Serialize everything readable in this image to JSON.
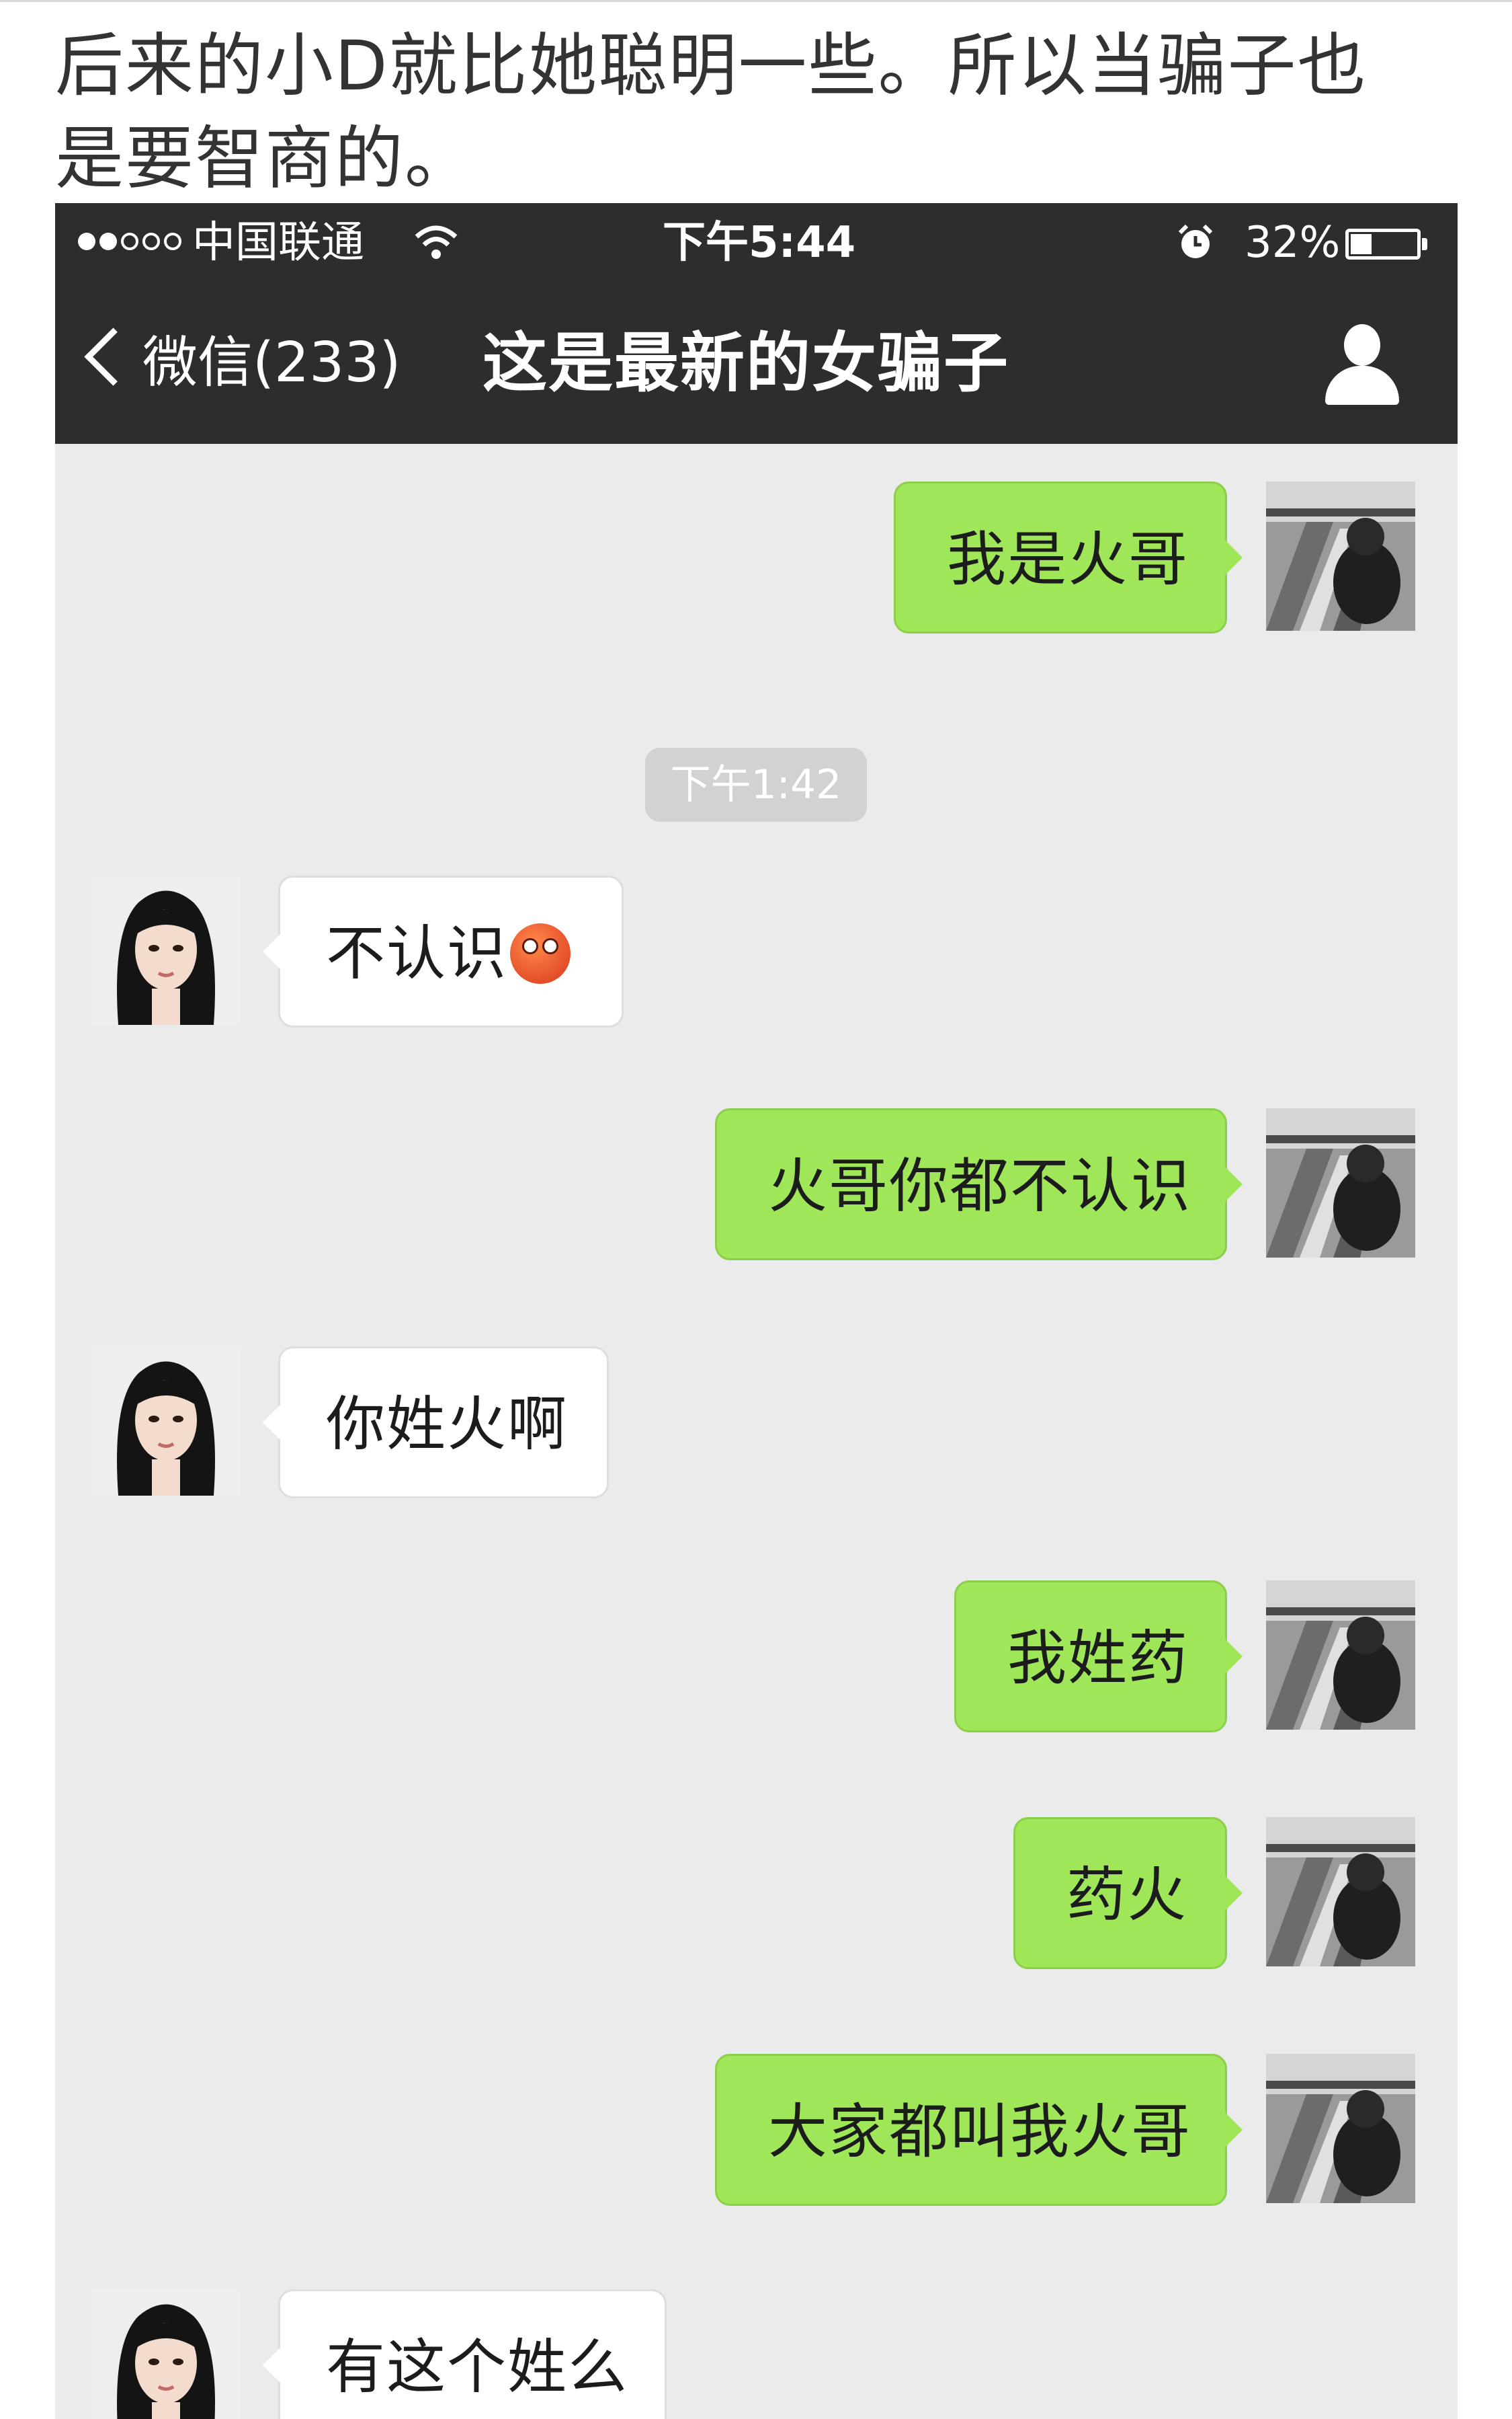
{
  "caption": "后来的小D就比她聪明一些。所以当骗子也是要智商的。",
  "status_bar": {
    "carrier": "中国联通",
    "time": "下午5:44",
    "battery": "32%",
    "battery_level": 0.32,
    "icons": [
      "signal-dots-icon",
      "wifi-icon",
      "alarm-icon",
      "battery-icon"
    ]
  },
  "nav": {
    "back_label": "微信(233)",
    "title": "这是最新的女骗子",
    "icons": [
      "chevron-left-icon",
      "person-icon"
    ]
  },
  "chat": {
    "timestamp": "下午1:42",
    "messages": [
      {
        "side": "out",
        "text": "我是火哥"
      },
      {
        "side": "in",
        "text": "不认识",
        "emoji": "flushed-face-icon"
      },
      {
        "side": "out",
        "text": "火哥你都不认识"
      },
      {
        "side": "in",
        "text": "你姓火啊"
      },
      {
        "side": "out",
        "text": "我姓药"
      },
      {
        "side": "out",
        "text": "药火"
      },
      {
        "side": "out",
        "text": "大家都叫我火哥"
      },
      {
        "side": "in",
        "text": "有这个姓么"
      }
    ]
  },
  "colors": {
    "header_bg": "#2d2d30",
    "chat_bg": "#ebebeb",
    "bubble_out": "#9fe658",
    "bubble_in": "#ffffff"
  }
}
